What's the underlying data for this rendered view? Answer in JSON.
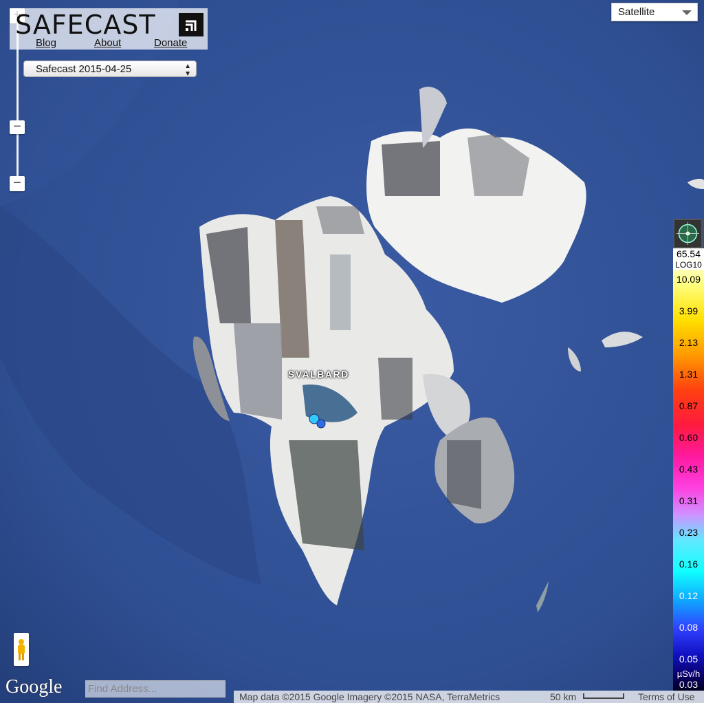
{
  "logo": {
    "text": "SAFECAST",
    "icon": "rss-feed-icon"
  },
  "links": {
    "blog": "Blog",
    "about": "About",
    "donate": "Donate"
  },
  "layer_select": {
    "value": "Safecast 2015-04-25"
  },
  "map_type": {
    "value": "Satellite"
  },
  "map": {
    "place_label": "SVALBARD",
    "sea_color": "#2f4f93",
    "snow_color": "#f4f4f2",
    "rock_color": "#5f6168"
  },
  "measurements": [
    {
      "color": "#33c8ff"
    },
    {
      "color": "#2d6ee6"
    }
  ],
  "legend": {
    "max": "65.54",
    "scale": "LOG10",
    "ticks": [
      "10.09",
      "3.99",
      "2.13",
      "1.31",
      "0.87",
      "0.60",
      "0.43",
      "0.31",
      "0.23",
      "0.16",
      "0.12",
      "0.08",
      "0.05"
    ],
    "unit": "µSv/h",
    "min": "0.03"
  },
  "search": {
    "placeholder": "Find Address..."
  },
  "google_logo": "Google",
  "attribution": {
    "map_data": "Map data ©2015 Google Imagery ©2015 NASA, TerraMetrics",
    "scale": "50 km",
    "terms": "Terms of Use"
  },
  "zoom": {
    "in": "+",
    "out": "−",
    "out2": "−"
  }
}
